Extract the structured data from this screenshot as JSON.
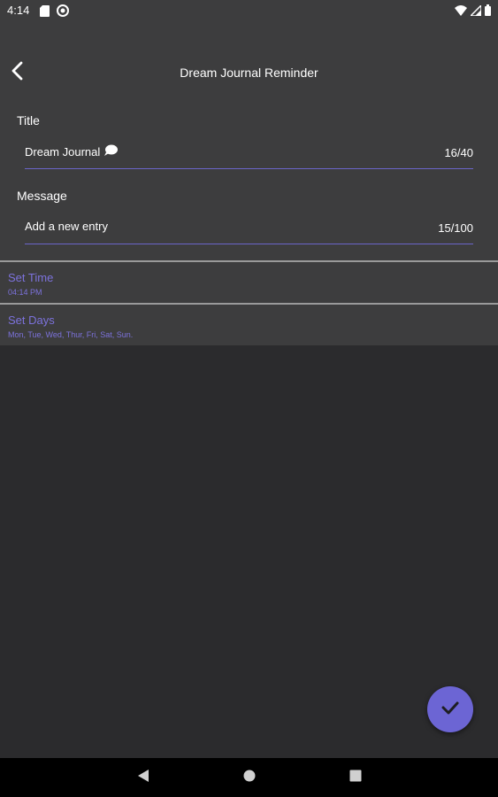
{
  "status_bar": {
    "time": "4:14",
    "left_icons": [
      "sd-card-icon",
      "sync-icon"
    ],
    "right_icons": [
      "wifi-icon",
      "signal-icon",
      "battery-icon"
    ]
  },
  "app_bar": {
    "title": "Dream Journal Reminder",
    "back_icon": "chevron-left-icon"
  },
  "form": {
    "title_label": "Title",
    "title_value": "Dream Journal",
    "title_emoji": "speech-bubble-icon",
    "title_counter": "16/40",
    "message_label": "Message",
    "message_value": "Add a new entry",
    "message_counter": "15/100"
  },
  "settings": {
    "time_title": "Set Time",
    "time_value": "04:14 PM",
    "days_title": "Set Days",
    "days_value": "Mon, Tue, Wed, Thur, Fri, Sat, Sun."
  },
  "fab": {
    "icon": "check-icon"
  },
  "colors": {
    "accent": "#6c65d4",
    "accent_text": "#7c72dc",
    "surface": "#3d3d3e",
    "background": "#2b2b2d"
  }
}
